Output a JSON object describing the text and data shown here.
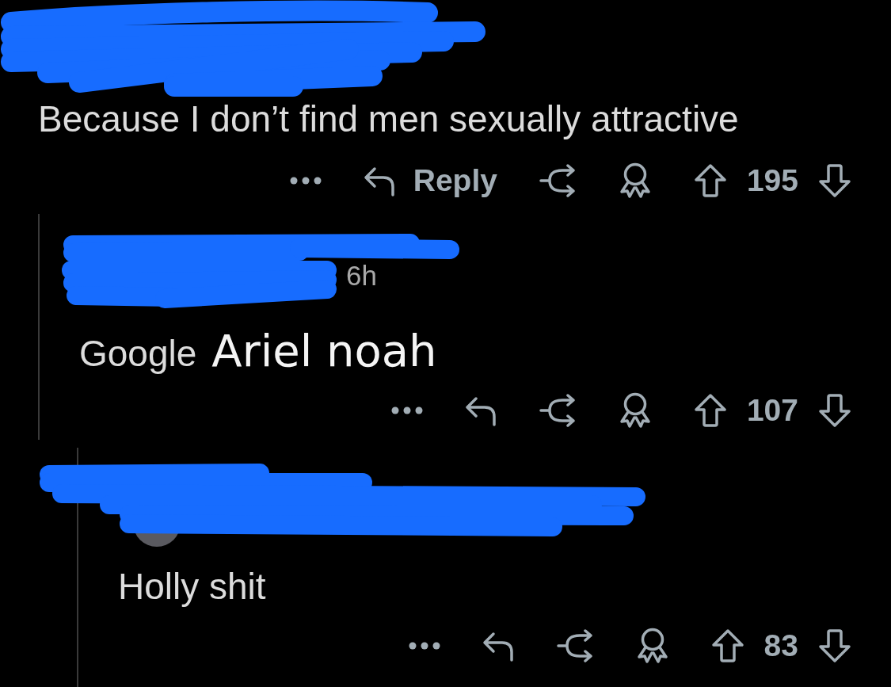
{
  "comments": [
    {
      "redacted": true,
      "body": [
        {
          "kind": "regular",
          "text": "Because I don’t find men sexually attractive"
        }
      ],
      "actions": {
        "reply_label": "Reply",
        "score": "195"
      },
      "children": [
        {
          "redacted": true,
          "timestamp": "6h",
          "body": [
            {
              "kind": "regular",
              "text": "Google"
            },
            {
              "kind": "large",
              "text": "Ariel noah"
            }
          ],
          "actions": {
            "score": "107"
          },
          "children": [
            {
              "redacted": true,
              "avatar": true,
              "body": [
                {
                  "kind": "regular",
                  "text": "Holly shit"
                }
              ],
              "actions": {
                "score": "83"
              }
            }
          ]
        }
      ]
    }
  ]
}
